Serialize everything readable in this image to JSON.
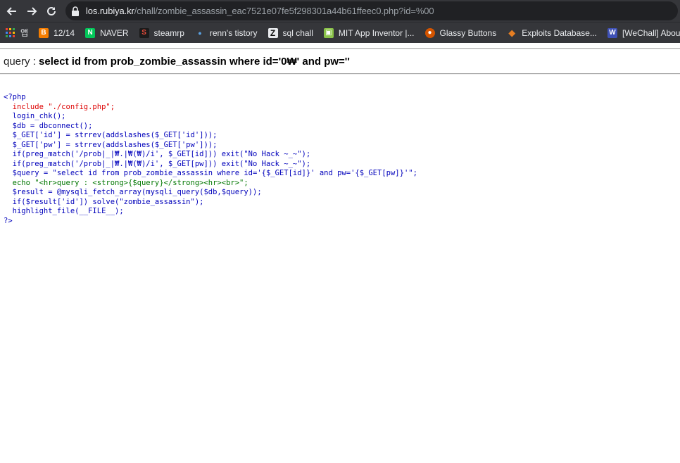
{
  "browser": {
    "url_host": "los.rubiya.kr",
    "url_path": "/chall/zombie_assassin_eac7521e07fe5f298301a44b61ffeec0.php?id=%00",
    "nav": {
      "back_icon": "arrow-left-icon",
      "forward_icon": "arrow-right-icon",
      "reload_icon": "reload-icon"
    },
    "bookmarks": [
      {
        "label": "앱",
        "icon": "apps-grid-icon",
        "color": "#4285f4"
      },
      {
        "label": "12/14",
        "icon": "blogger-icon",
        "color": "#f57d00"
      },
      {
        "label": "NAVER",
        "icon": "naver-icon",
        "color": "#03c75a"
      },
      {
        "label": "steamrp",
        "icon": "steamrp-icon",
        "color": "#c0392b"
      },
      {
        "label": "renn's tistory",
        "icon": "tistory-icon",
        "color": "#5aa0e0"
      },
      {
        "label": "sql chall",
        "icon": "z-icon",
        "color": "#222222"
      },
      {
        "label": "MIT App Inventor |...",
        "icon": "app-inventor-icon",
        "color": "#8bc34a"
      },
      {
        "label": "Glassy Buttons",
        "icon": "glassy-icon",
        "color": "#d35400"
      },
      {
        "label": "Exploits Database...",
        "icon": "exploitdb-icon",
        "color": "#e67e22"
      },
      {
        "label": "[WeChall] About...",
        "icon": "wechall-icon",
        "color": "#3f51b5"
      }
    ]
  },
  "page": {
    "query_label": "query : ",
    "query_value": "select id from prob_zombie_assassin where id='0₩' and pw=''",
    "code_lines": [
      {
        "text": "<?php",
        "color": "#0000BB"
      },
      {
        "text": "  include \"./config.php\";",
        "color": "#DD0000"
      },
      {
        "text": "  login_chk();",
        "color": "#0000BB"
      },
      {
        "text": "  $db = dbconnect();",
        "color": "#0000BB"
      },
      {
        "text": "  $_GET['id'] = strrev(addslashes($_GET['id']));",
        "color": "#0000BB"
      },
      {
        "text": "  $_GET['pw'] = strrev(addslashes($_GET['pw']));",
        "color": "#0000BB"
      },
      {
        "text": "  if(preg_match('/prob|_|₩.|₩(₩)/i', $_GET[id])) exit(\"No Hack ~_~\");",
        "color": "#0000BB"
      },
      {
        "text": "  if(preg_match('/prob|_|₩.|₩(₩)/i', $_GET[pw])) exit(\"No Hack ~_~\");",
        "color": "#0000BB"
      },
      {
        "text": "  $query = \"select id from prob_zombie_assassin where id='{$_GET[id]}' and pw='{$_GET[pw]}'\";",
        "color": "#0000BB"
      },
      {
        "text": "  echo \"<hr>query : <strong>{$query}</strong><hr><br>\";",
        "color": "#007700"
      },
      {
        "text": "  $result = @mysqli_fetch_array(mysqli_query($db,$query));",
        "color": "#0000BB"
      },
      {
        "text": "  if($result['id']) solve(\"zombie_assassin\");",
        "color": "#0000BB"
      },
      {
        "text": "  highlight_file(__FILE__);",
        "color": "#0000BB"
      },
      {
        "text": "?>",
        "color": "#0000BB"
      }
    ]
  }
}
